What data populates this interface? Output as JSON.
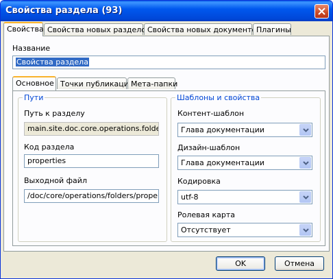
{
  "window": {
    "title": "Свойства раздела (93)"
  },
  "main_tabs": [
    {
      "label": "Свойства"
    },
    {
      "label": "Свойства новых разделов"
    },
    {
      "label": "Свойства новых документов"
    },
    {
      "label": "Плагины"
    }
  ],
  "name_field": {
    "label": "Название",
    "value": "Свойства раздела"
  },
  "sub_tabs": [
    {
      "label": "Основное"
    },
    {
      "label": "Точки публикации"
    },
    {
      "label": "Мета-папки"
    }
  ],
  "paths": {
    "legend": "Пути",
    "section_path_label": "Путь к разделу",
    "section_path_value": "main.site.doc.core.operations.folders",
    "section_code_label": "Код раздела",
    "section_code_value": "properties",
    "output_file_label": "Выходной файл",
    "output_file_value": "/doc/core/operations/folders/properti"
  },
  "templates": {
    "legend": "Шаблоны и свойства",
    "content_template_label": "Контент-шаблон",
    "content_template_value": "Глава документации",
    "design_template_label": "Дизайн-шаблон",
    "design_template_value": "Глава документации",
    "encoding_label": "Кодировка",
    "encoding_value": "utf-8",
    "role_map_label": "Ролевая карта",
    "role_map_value": "Отсутствует"
  },
  "buttons": {
    "ok": "OK",
    "cancel": "Отмена"
  }
}
